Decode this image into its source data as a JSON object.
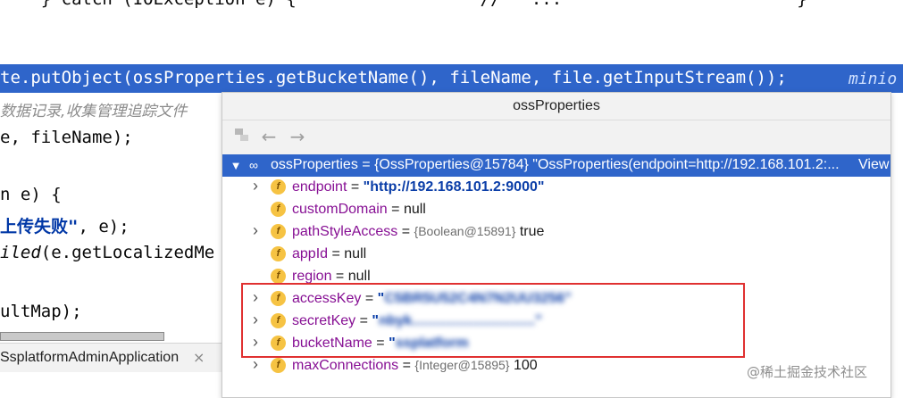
{
  "editor": {
    "line_top": "    } catch (IOException e) {                  //   ...                       }",
    "line_highlight": "te.putObject(ossProperties.getBucketName(), fileName, file.getInputStream());",
    "inlay_hint": "minio",
    "line_comment": "数据记录,收集管理追踪文件",
    "line_3": "e, fileName);",
    "line_4": "n e) {",
    "line_5_str": "上传失败\"",
    "line_5_rest": ", e);",
    "line_6_ital": "iled",
    "line_6_rest": "(e.getLocalizedMe",
    "line_7": "ultMap);",
    "tab_label": "SsplatformAdminApplication",
    "tab_close": "×"
  },
  "popup": {
    "title": "ossProperties",
    "toolbar": {
      "back": "←",
      "forward": "→"
    },
    "root": {
      "name": "ossProperties",
      "value": " = {OssProperties@15784} \"OssProperties(endpoint=http://192.168.101.2:...",
      "view": "View"
    },
    "fields": [
      {
        "name": "endpoint",
        "eq": " = ",
        "value": "\"http://192.168.101.2:9000\"",
        "kind": "str",
        "expandable": true
      },
      {
        "name": "customDomain",
        "eq": " = ",
        "value": "null",
        "kind": "plain",
        "expandable": false
      },
      {
        "name": "pathStyleAccess",
        "eq": " = ",
        "value": "{Boolean@15891}",
        "extra": " true",
        "kind": "obj",
        "expandable": true
      },
      {
        "name": "appId",
        "eq": " = ",
        "value": "null",
        "kind": "plain",
        "expandable": false
      },
      {
        "name": "region",
        "eq": " = ",
        "value": "null",
        "kind": "plain",
        "expandable": false
      },
      {
        "name": "accessKey",
        "eq": " = ",
        "value": "\"C5BR5U52C4N7N2UU3256\"",
        "kind": "blurstr",
        "expandable": true
      },
      {
        "name": "secretKey",
        "eq": " = ",
        "value": "\"nbyk...............................\"",
        "kind": "blurstr",
        "expandable": true
      },
      {
        "name": "bucketName",
        "eq": " = ",
        "value": "\"ssplatform",
        "kind": "blurstr",
        "expandable": true
      },
      {
        "name": "maxConnections",
        "eq": " = ",
        "value": "{Integer@15895}",
        "extra": " 100",
        "kind": "obj",
        "expandable": true
      }
    ],
    "badge_letter": "f"
  },
  "watermark": "@稀土掘金技术社区",
  "colors": {
    "selection": "#2f65ca",
    "highlight_box": "#e03131",
    "field_name": "#871094",
    "string_value": "#0b3ea8"
  }
}
